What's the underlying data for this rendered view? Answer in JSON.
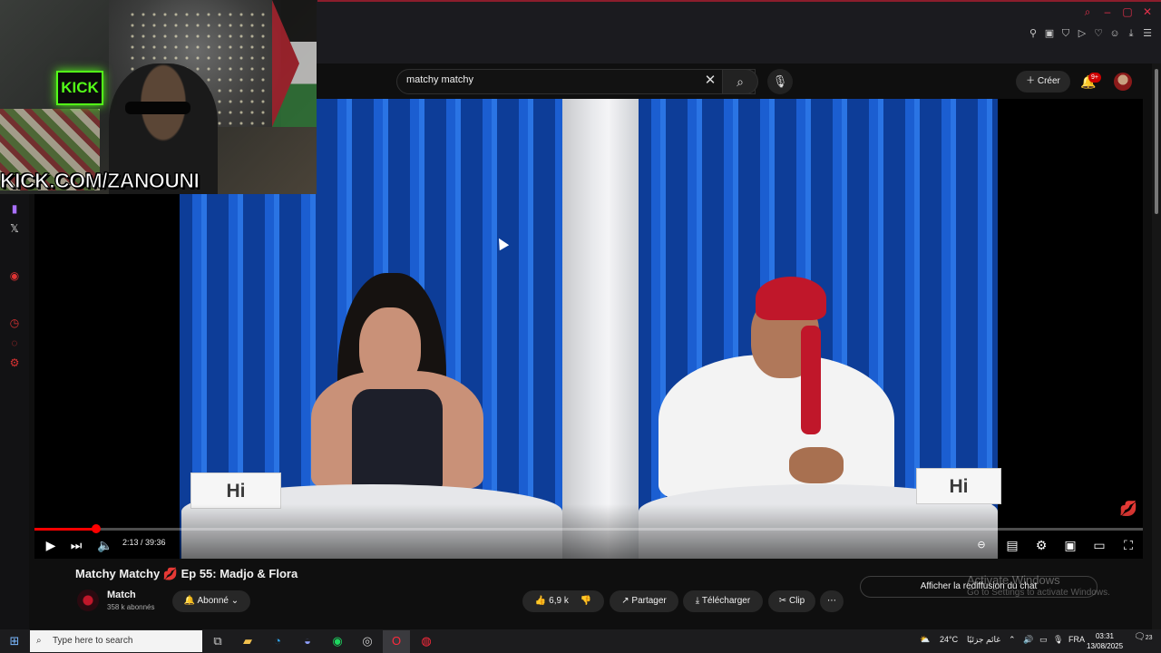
{
  "webcam": {
    "overlay_url": "KICK.COM/ZANOUNI",
    "logo_text": "KICK"
  },
  "browser": {
    "window_controls": [
      "search-icon",
      "minimize-icon",
      "maximize-icon",
      "close-icon"
    ],
    "extensions": [
      "pin-icon",
      "tabs-icon",
      "shield-icon",
      "play-icon",
      "heart-icon",
      "profile-icon",
      "download-icon",
      "menu-icon"
    ]
  },
  "sidebar": {
    "items": [
      "twitch-icon",
      "x-icon",
      "opera-icon",
      "history-icon",
      "chat-icon",
      "settings-icon"
    ]
  },
  "youtube_header": {
    "search_value": "matchy matchy",
    "create_label": "Créer",
    "notification_count": "9+"
  },
  "video": {
    "left_sign": "Hi",
    "right_sign": "Hi",
    "time": "2:13 / 39:36",
    "progress": 0.056,
    "watermark_icon": "lips-icon"
  },
  "details": {
    "title": "Matchy Matchy 💋 Ep 55: Madjo & Flora",
    "channel_name": "Match",
    "subscribers": "358 k abonnés",
    "subscribed_label": "Abonné",
    "likes": "6,9 k",
    "share_label": "Partager",
    "download_label": "Télécharger",
    "clip_label": "Clip",
    "chat_replay_label": "Afficher la rediffusion du chat"
  },
  "watermark": {
    "line1": "Activate Windows",
    "line2": "Go to Settings to activate Windows."
  },
  "taskbar": {
    "search_placeholder": "Type here to search",
    "weather": "24°C",
    "weather_text": "غائم جزئيًا",
    "language": "FRA",
    "time": "03:31",
    "date": "13/08/2025",
    "notifications": "23"
  },
  "colors": {
    "youtube_red": "#ff0000",
    "kick_green": "#53fc18",
    "opera_red": "#e0304a"
  }
}
